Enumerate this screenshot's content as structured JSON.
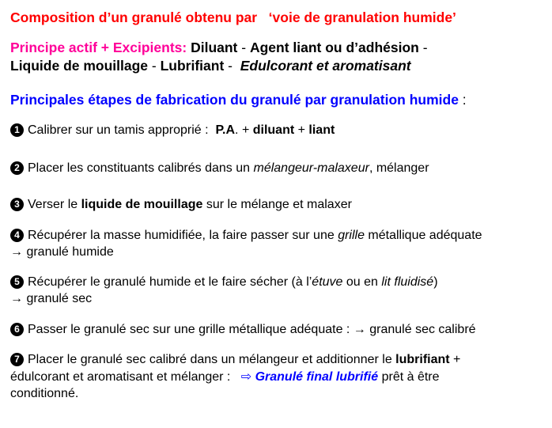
{
  "title": {
    "part1": "Composition d’un granulé obtenu par",
    "part2": "‘voie de granulation humide’"
  },
  "principle": {
    "label": "Principe actif + Excipients:",
    "diluant": "Diluant",
    "sep1": " - ",
    "agent": "Agent liant ou d’adhésion",
    "sep2": " -",
    "liquide": "Liquide de mouillage",
    "sep3": " - ",
    "lubrifiant": "Lubrifiant",
    "sep4": " -  ",
    "edulcorant": "Edulcorant et aromatisant"
  },
  "steps_heading": {
    "text": "Principales étapes de fabrication du granulé par granulation humide",
    "colon": " :"
  },
  "steps": [
    {
      "number": "1",
      "a": "Calibrer sur un tamis approprié :  ",
      "b": "P.A",
      "c": ". + ",
      "d": "diluant",
      "e": " + ",
      "f": "liant"
    },
    {
      "number": "2",
      "a": "Placer les constituants calibrés dans un ",
      "b": "mélangeur-malaxeur",
      "c": ", mélanger"
    },
    {
      "number": "3",
      "a": "Verser le ",
      "b": "liquide de mouillage",
      "c": " sur le mélange et malaxer"
    },
    {
      "number": "4",
      "a": "Récupérer la masse humidifiée, la faire passer sur une ",
      "b": "grille",
      "c": " métallique adéquate",
      "line2_arrow": "→",
      "line2_text": " granulé humide"
    },
    {
      "number": "5",
      "a": "Récupérer le granulé humide et le faire sécher (à l’",
      "b": "étuve",
      "c": " ou en ",
      "d": "lit fluidisé",
      "e": ")",
      "line2_arrow": "→",
      "line2_text": " granulé sec"
    },
    {
      "number": "6",
      "a": "Passer le granulé sec sur une grille métallique adéquate : ",
      "arrow": "→",
      "b": " granulé sec calibré"
    },
    {
      "number": "7",
      "a": "Placer le granulé sec calibré dans un mélangeur et additionner le ",
      "b": "lubrifiant",
      "c": " +",
      "line2_a": "édulcorant et aromatisant et mélanger :   ",
      "line2_arrow": "⇨",
      "line2_b": " Granulé final lubrifié",
      "line2_c": " prêt à être",
      "line3": "conditionné."
    }
  ],
  "colors": {
    "title": "#ff0000",
    "principle_label": "#ff0099",
    "heading": "#0000ff",
    "final": "#0000ff"
  }
}
